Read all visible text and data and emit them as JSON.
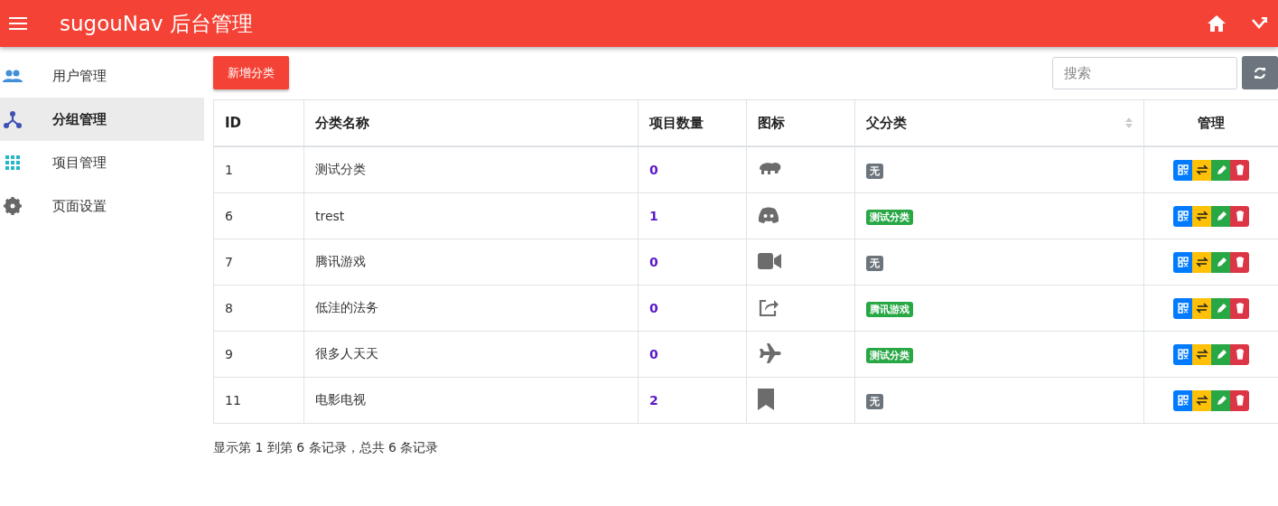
{
  "header": {
    "title": "sugouNav 后台管理"
  },
  "sidebar": {
    "items": [
      {
        "label": "用户管理",
        "selected": false
      },
      {
        "label": "分组管理",
        "selected": true
      },
      {
        "label": "项目管理",
        "selected": false
      },
      {
        "label": "页面设置",
        "selected": false
      }
    ]
  },
  "toolbar": {
    "add_button": "新增分类",
    "search": {
      "placeholder": "搜索"
    }
  },
  "table": {
    "columns": [
      "ID",
      "分类名称",
      "项目数量",
      "图标",
      "父分类",
      "管理"
    ],
    "rows": [
      {
        "id": "1",
        "name": "测试分类",
        "count": "0",
        "parent": {
          "label": "无",
          "color": "#6c757d"
        }
      },
      {
        "id": "6",
        "name": "trest",
        "count": "1",
        "parent": {
          "label": "测试分类",
          "color": "#28a745"
        }
      },
      {
        "id": "7",
        "name": "腾讯游戏",
        "count": "0",
        "parent": {
          "label": "无",
          "color": "#6c757d"
        }
      },
      {
        "id": "8",
        "name": "低洼的法务",
        "count": "0",
        "parent": {
          "label": "腾讯游戏",
          "color": "#28a745"
        }
      },
      {
        "id": "9",
        "name": "很多人天天",
        "count": "0",
        "parent": {
          "label": "测试分类",
          "color": "#28a745"
        }
      },
      {
        "id": "11",
        "name": "电影电视",
        "count": "2",
        "parent": {
          "label": "无",
          "color": "#6c757d"
        }
      }
    ]
  },
  "pagination": {
    "summary": "显示第 1 到第 6 条记录，总共 6 条记录"
  }
}
